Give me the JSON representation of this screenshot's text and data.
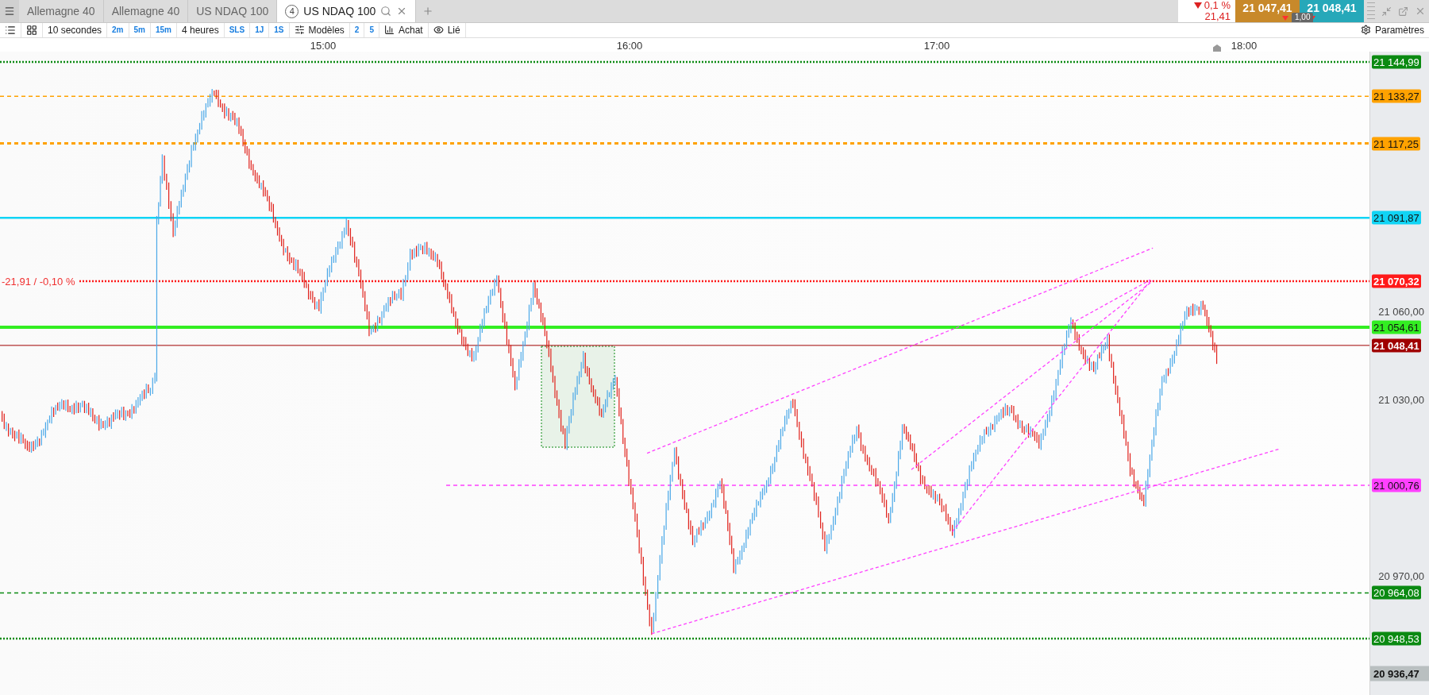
{
  "tabs": [
    {
      "label": "Allemagne 40",
      "selected": false
    },
    {
      "label": "Allemagne 40",
      "selected": false
    },
    {
      "label": "US NDAQ 100",
      "selected": false
    },
    {
      "label": "US NDAQ 100",
      "selected": true,
      "badge": "4"
    }
  ],
  "quote": {
    "down": true,
    "change": "0,1 %",
    "points": "21,41",
    "sell": "21 047,41",
    "buy": "21 048,41",
    "spread": "1,00"
  },
  "toolbar": [
    {
      "kind": "icon"
    },
    {
      "kind": "icon"
    },
    {
      "kind": "text",
      "label": "10 secondes"
    },
    {
      "kind": "blue",
      "label": "2m"
    },
    {
      "kind": "blue",
      "label": "5m"
    },
    {
      "kind": "blue",
      "label": "15m"
    },
    {
      "kind": "text",
      "label": "4 heures"
    },
    {
      "kind": "blue",
      "label": "SLS"
    },
    {
      "kind": "blue",
      "label": "1J"
    },
    {
      "kind": "blue",
      "label": "1S"
    },
    {
      "kind": "icontext",
      "label": "Modèles"
    },
    {
      "kind": "blue",
      "label": "2"
    },
    {
      "kind": "blue",
      "label": "5"
    },
    {
      "kind": "icontext",
      "label": "Achat"
    },
    {
      "kind": "icontext",
      "label": "Lié"
    }
  ],
  "settings": {
    "label": "Paramètres"
  },
  "time_labels": [
    "15:00",
    "16:00",
    "17:00",
    "18:00"
  ],
  "axis_ticks": [
    "21 060,00",
    "21 030,00",
    "20 970,00"
  ],
  "levels": [
    {
      "label": "21 144,99",
      "color": "#0b8a12",
      "kind": "dotted"
    },
    {
      "label": "21 133,27",
      "color": "#ffa200",
      "kind": "dashed"
    },
    {
      "label": "21 117,25",
      "color": "#ffa200",
      "kind": "thickdashed"
    },
    {
      "label": "21 091,87",
      "color": "#10d4f5",
      "kind": "solid"
    },
    {
      "label": "21 070,32",
      "color": "#ff1a1a",
      "kind": "dotted",
      "note": "-21,91 / -0,10 %"
    },
    {
      "label": "21 054,61",
      "color": "#33ee22",
      "kind": "thick"
    },
    {
      "label": "21 048,41",
      "color": "#a00000",
      "kind": "thin"
    },
    {
      "label": "21 000,76",
      "color": "#ff40ff",
      "kind": "dashed"
    },
    {
      "label": "20 964,08",
      "color": "#0b8a12",
      "kind": "dashed"
    },
    {
      "label": "20 948,53",
      "color": "#0b8a12",
      "kind": "dotted"
    }
  ],
  "last_price": "20 936,47"
}
